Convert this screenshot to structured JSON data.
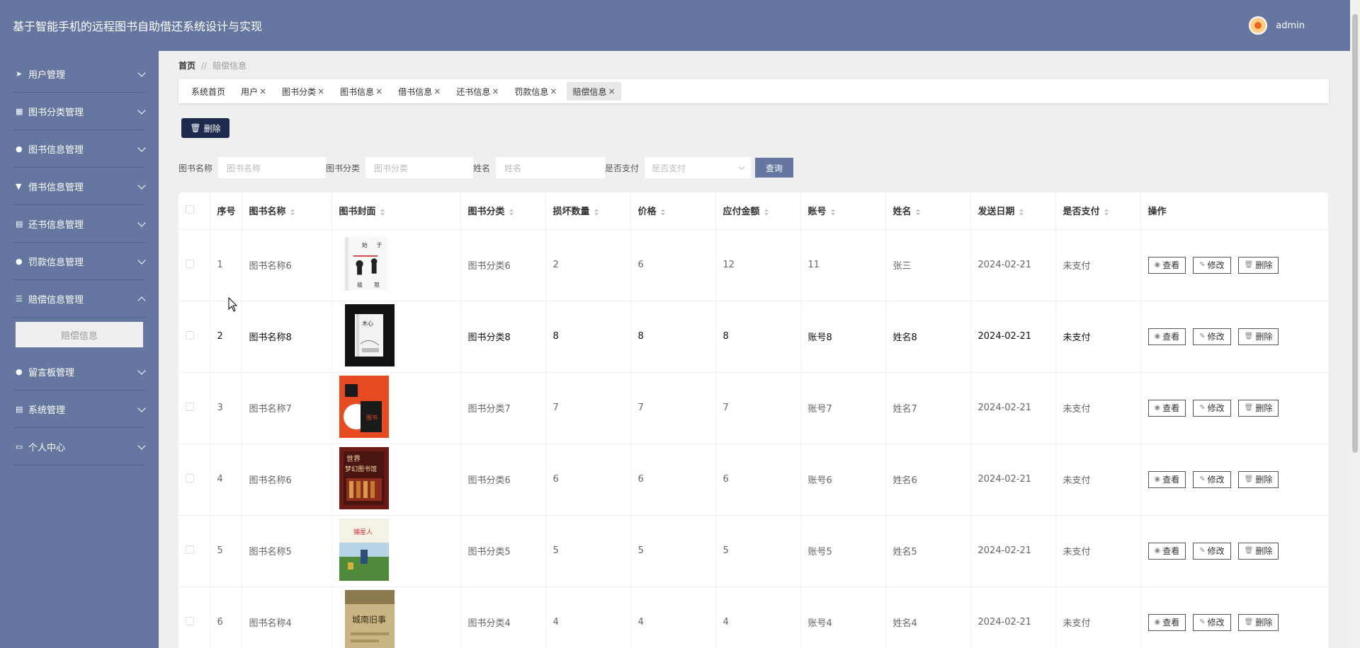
{
  "header": {
    "title": "基于智能手机的远程图书自助借还系统设计与实现",
    "username": "admin"
  },
  "sidebar": {
    "items": [
      {
        "label": "用户管理",
        "icon": "send-icon",
        "expanded": false
      },
      {
        "label": "图书分类管理",
        "icon": "grid-icon",
        "expanded": false
      },
      {
        "label": "图书信息管理",
        "icon": "pin-icon",
        "expanded": false
      },
      {
        "label": "借书信息管理",
        "icon": "sign-icon",
        "expanded": false
      },
      {
        "label": "还书信息管理",
        "icon": "clipboard-icon",
        "expanded": false
      },
      {
        "label": "罚款信息管理",
        "icon": "user-icon",
        "expanded": false
      },
      {
        "label": "赔偿信息管理",
        "icon": "list-icon",
        "expanded": true,
        "sub": [
          "赔偿信息"
        ]
      },
      {
        "label": "留言板管理",
        "icon": "user-icon",
        "expanded": false
      },
      {
        "label": "系统管理",
        "icon": "clipboard-icon",
        "expanded": false
      },
      {
        "label": "个人中心",
        "icon": "card-icon",
        "expanded": false
      }
    ]
  },
  "breadcrumb": {
    "home": "首页",
    "sep": "//",
    "current": "赔偿信息"
  },
  "tabs": [
    {
      "label": "系统首页",
      "closable": false
    },
    {
      "label": "用户",
      "closable": true
    },
    {
      "label": "图书分类",
      "closable": true
    },
    {
      "label": "图书信息",
      "closable": true
    },
    {
      "label": "借书信息",
      "closable": true
    },
    {
      "label": "还书信息",
      "closable": true
    },
    {
      "label": "罚款信息",
      "closable": true
    },
    {
      "label": "赔偿信息",
      "closable": true,
      "active": true
    }
  ],
  "toolbar": {
    "delete_label": "删除"
  },
  "search": {
    "book_name_label": "图书名称",
    "book_name_placeholder": "图书名称",
    "category_label": "图书分类",
    "category_placeholder": "图书分类",
    "name_label": "姓名",
    "name_placeholder": "姓名",
    "paid_label": "是否支付",
    "paid_placeholder": "是否支付",
    "query_label": "查询"
  },
  "table": {
    "headers": [
      "序号",
      "图书名称",
      "图书封面",
      "图书分类",
      "损坏数量",
      "价格",
      "应付金额",
      "账号",
      "姓名",
      "发送日期",
      "是否支付",
      "操作"
    ],
    "rows": [
      {
        "no": "1",
        "book": "图书名称6",
        "category": "图书分类6",
        "damaged": "2",
        "price": "6",
        "amount": "12",
        "account": "11",
        "name": "张三",
        "date": "2024-02-21",
        "paid": "未支付",
        "cover": "white-martial"
      },
      {
        "no": "2",
        "book": "图书名称8",
        "category": "图书分类8",
        "damaged": "8",
        "price": "8",
        "amount": "8",
        "account": "账号8",
        "name": "姓名8",
        "date": "2024-02-21",
        "paid": "未支付",
        "cover": "black-book"
      },
      {
        "no": "3",
        "book": "图书名称7",
        "category": "图书分类7",
        "damaged": "7",
        "price": "7",
        "amount": "7",
        "account": "账号7",
        "name": "姓名7",
        "date": "2024-02-21",
        "paid": "未支付",
        "cover": "red-book"
      },
      {
        "no": "4",
        "book": "图书名称6",
        "category": "图书分类6",
        "damaged": "6",
        "price": "6",
        "amount": "6",
        "account": "账号6",
        "name": "姓名6",
        "date": "2024-02-21",
        "paid": "未支付",
        "cover": "library-book"
      },
      {
        "no": "5",
        "book": "图书名称5",
        "category": "图书分类5",
        "damaged": "5",
        "price": "5",
        "amount": "5",
        "account": "账号5",
        "name": "姓名5",
        "date": "2024-02-21",
        "paid": "未支付",
        "cover": "field-book"
      },
      {
        "no": "6",
        "book": "图书名称4",
        "category": "图书分类4",
        "damaged": "4",
        "price": "4",
        "amount": "4",
        "account": "账号4",
        "name": "姓名4",
        "date": "2024-02-21",
        "paid": "未支付",
        "cover": "old-book"
      }
    ],
    "actions": {
      "view": "查看",
      "edit": "修改",
      "delete": "删除"
    }
  }
}
